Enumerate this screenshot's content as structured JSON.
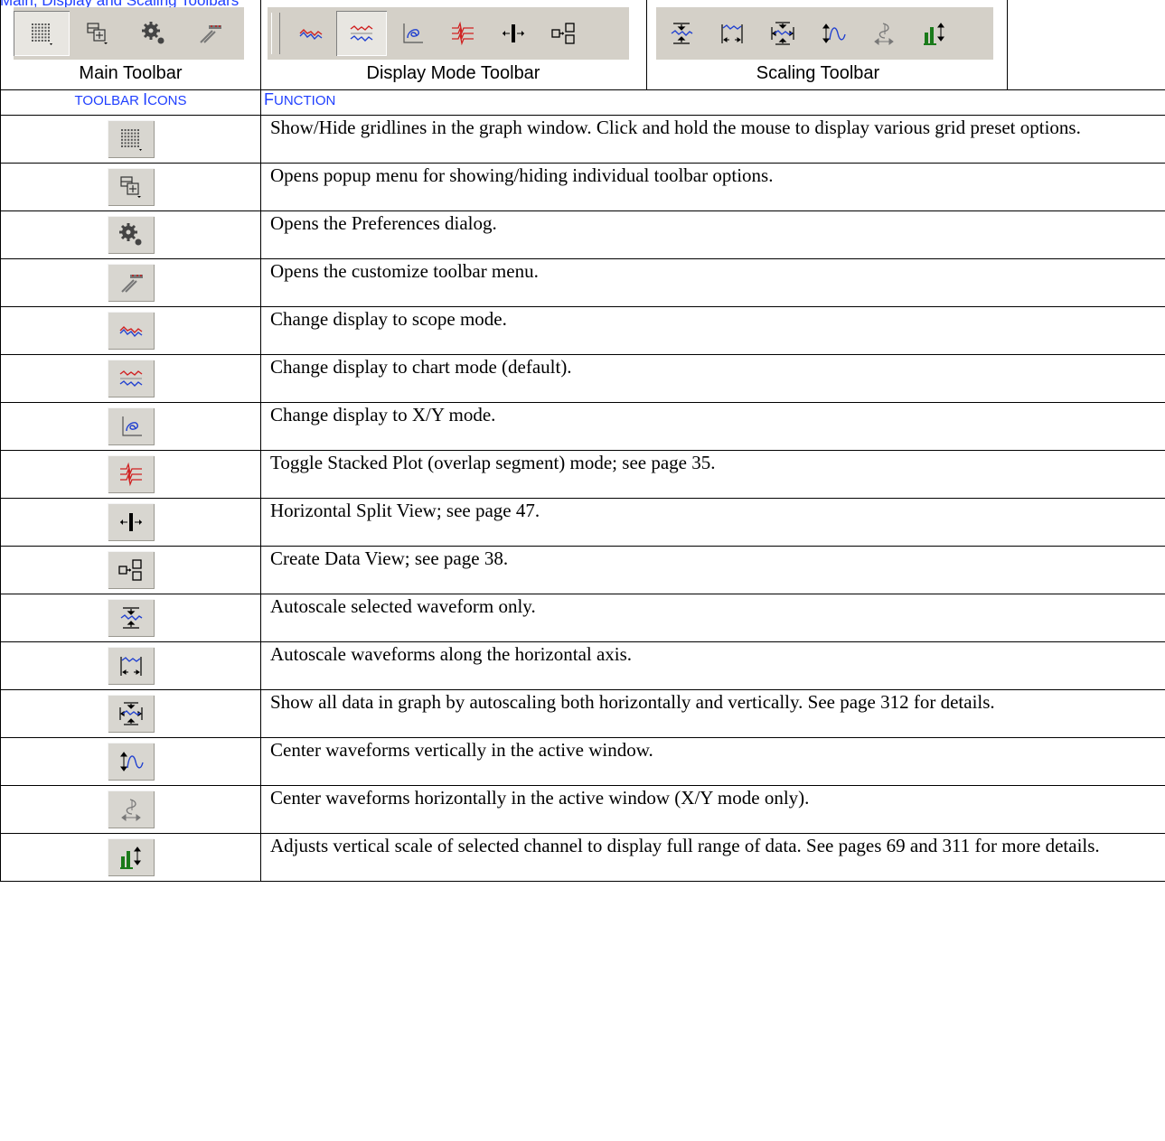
{
  "heading": "Main, Display and Scaling Toolbars",
  "toolbars": [
    {
      "label": "Main Toolbar",
      "icons": [
        "grid-icon",
        "toolbar-options-icon",
        "preferences-gear-icon",
        "customize-toolbar-icon"
      ]
    },
    {
      "label": "Display Mode Toolbar",
      "icons": [
        "scope-mode-icon",
        "chart-mode-icon",
        "xy-mode-icon",
        "stacked-plot-icon",
        "horizontal-split-icon",
        "create-data-view-icon"
      ]
    },
    {
      "label": "Scaling Toolbar",
      "icons": [
        "autoscale-selected-icon",
        "autoscale-horizontal-icon",
        "autoscale-all-icon",
        "center-vertical-icon",
        "center-horizontal-icon",
        "adjust-vertical-scale-icon"
      ]
    }
  ],
  "table": {
    "header_icons_small": "TOOLBAR ",
    "header_icons_big": "I",
    "header_icons_rest": "CONS",
    "header_function_big": "F",
    "header_function_rest": "UNCTION",
    "rows": [
      {
        "icon": "grid-icon",
        "text": "Show/Hide gridlines in the graph window. Click and hold the mouse to display various grid preset options."
      },
      {
        "icon": "toolbar-options-icon",
        "text": "Opens popup menu for showing/hiding individual toolbar options."
      },
      {
        "icon": "preferences-gear-icon",
        "text": "Opens the Preferences dialog."
      },
      {
        "icon": "customize-toolbar-icon",
        "text": "Opens the customize toolbar menu."
      },
      {
        "icon": "scope-mode-icon",
        "text": "Change display to scope mode."
      },
      {
        "icon": "chart-mode-icon",
        "text": "Change display to chart mode (default)."
      },
      {
        "icon": "xy-mode-icon",
        "text": "Change display to X/Y mode."
      },
      {
        "icon": "stacked-plot-icon",
        "text": "Toggle Stacked Plot (overlap segment) mode; see page 35."
      },
      {
        "icon": "horizontal-split-icon",
        "text": "Horizontal Split View; see page 47."
      },
      {
        "icon": "create-data-view-icon",
        "text": "Create Data View; see page 38."
      },
      {
        "icon": "autoscale-selected-icon",
        "text": "Autoscale selected waveform only."
      },
      {
        "icon": "autoscale-horizontal-icon",
        "text": "Autoscale waveforms along the horizontal axis."
      },
      {
        "icon": "autoscale-all-icon",
        "text": "Show all data in graph by autoscaling both horizontally and vertically. See page 312 for details."
      },
      {
        "icon": "center-vertical-icon",
        "text": "Center waveforms vertically in the active window."
      },
      {
        "icon": "center-horizontal-icon",
        "text": "Center waveforms horizontally in the active window (X/Y mode only)."
      },
      {
        "icon": "adjust-vertical-scale-icon",
        "text": "Adjusts vertical scale of selected channel to display full range of data. See pages 69 and 311 for more details."
      }
    ]
  }
}
